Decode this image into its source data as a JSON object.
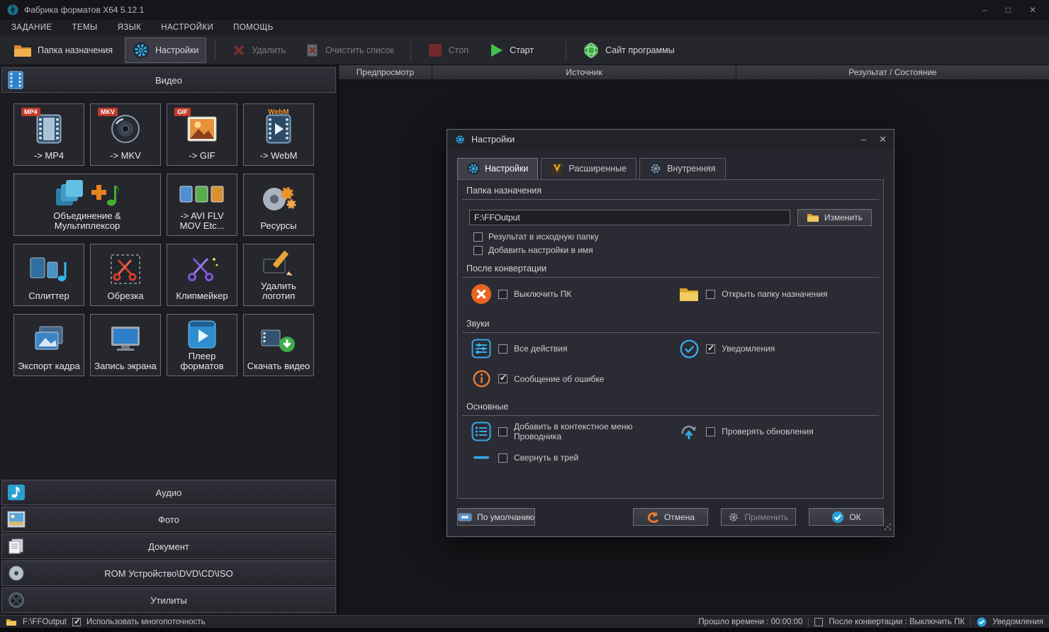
{
  "window": {
    "title": "Фабрика форматов X64 5.12.1",
    "controls": {
      "minimize": "–",
      "maximize": "□",
      "close": "✕"
    }
  },
  "menubar": {
    "items": [
      {
        "label": "ЗАДАНИЕ"
      },
      {
        "label": "ТЕМЫ"
      },
      {
        "label": "ЯЗЫК"
      },
      {
        "label": "НАСТРОЙКИ"
      },
      {
        "label": "ПОМОЩЬ"
      }
    ]
  },
  "toolbar": {
    "dest_folder": "Папка назначения",
    "settings": "Настройки",
    "remove": "Удалить",
    "clear_list": "Очистить список",
    "stop": "Стоп",
    "start": "Старт",
    "website": "Сайт программы"
  },
  "sidebar": {
    "video_header": "Видео",
    "tiles": [
      {
        "label": "-> MP4",
        "badge": "MP4"
      },
      {
        "label": "-> MKV",
        "badge": "MKV"
      },
      {
        "label": "-> GIF",
        "badge": "GIF"
      },
      {
        "label": "-> WebM",
        "badge": "WebM"
      },
      {
        "label": "Объединение & Мультиплексор"
      },
      {
        "label": "-> AVI FLV MOV Etc..."
      },
      {
        "label": "Ресурсы"
      },
      {
        "label": "Сплиттер"
      },
      {
        "label": "Обрезка"
      },
      {
        "label": "Клипмейкер"
      },
      {
        "label": "Удалить логотип"
      },
      {
        "label": "Экспорт кадра"
      },
      {
        "label": "Запись экрана"
      },
      {
        "label": "Плеер форматов"
      },
      {
        "label": "Скачать видео"
      }
    ],
    "sections": [
      {
        "label": "Аудио"
      },
      {
        "label": "Фото"
      },
      {
        "label": "Документ"
      },
      {
        "label": "ROM Устройство\\DVD\\CD\\ISO"
      },
      {
        "label": "Утилиты"
      }
    ]
  },
  "filelist": {
    "headers": [
      "Предпросмотр",
      "Источник",
      "Результат / Состояние"
    ]
  },
  "dialog": {
    "title": "Настройки",
    "controls": {
      "minimize": "–",
      "close": "✕"
    },
    "tabs": [
      {
        "label": "Настройки"
      },
      {
        "label": "Расширенные"
      },
      {
        "label": "Внутренняя"
      }
    ],
    "section_dest": "Папка назначения",
    "dest_path": "F:\\FFOutput",
    "change_button": "Изменить",
    "section_after": "После конвертации",
    "section_sounds": "Звуки",
    "section_general": "Основные",
    "checks": {
      "result_to_source": {
        "label": "Результат в исходную папку",
        "checked": false
      },
      "add_settings_to_name": {
        "label": "Добавить настройки в имя",
        "checked": false
      },
      "shutdown_pc": {
        "label": "Выключить ПК",
        "checked": false
      },
      "open_dest_folder": {
        "label": "Открыть папку назначения",
        "checked": false
      },
      "all_actions": {
        "label": "Все действия",
        "checked": false
      },
      "notifications": {
        "label": "Уведомления",
        "checked": true
      },
      "error_message": {
        "label": "Сообщение об ошибке",
        "checked": true
      },
      "context_menu": {
        "label": "Добавить в контекстное меню Проводника",
        "checked": false
      },
      "check_updates": {
        "label": "Проверять обновления",
        "checked": false
      },
      "minimize_tray": {
        "label": "Свернуть в трей",
        "checked": false
      }
    },
    "buttons": {
      "default": "По умолчанию",
      "cancel": "Отмена",
      "apply": "Применить",
      "ok": "ОК"
    }
  },
  "statusbar": {
    "dest_path": "F:\\FFOutput",
    "multithread": {
      "label": "Использовать многопоточность",
      "checked": true
    },
    "elapsed": "Прошло времени : 00:00:00",
    "after_convert": {
      "label": "После конвертации : Выключить ПК",
      "checked": false
    },
    "notifications": "Уведомления"
  }
}
